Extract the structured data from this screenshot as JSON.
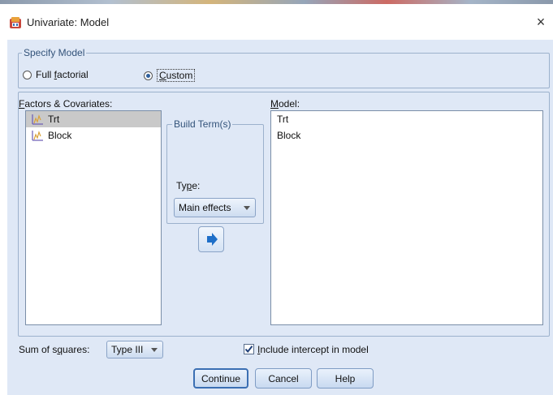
{
  "window": {
    "title": "Univariate: Model",
    "close_glyph": "×"
  },
  "specify_model": {
    "legend": "Specify Model",
    "options": [
      {
        "label_pre": "Full ",
        "label_mnemonic": "f",
        "label_post": "actorial",
        "selected": false
      },
      {
        "label_pre": "",
        "label_mnemonic": "C",
        "label_post": "ustom",
        "selected": true
      }
    ]
  },
  "factors": {
    "label_mnemonic": "F",
    "label_rest": "actors & Covariates:",
    "items": [
      {
        "name": "Trt",
        "selected": true
      },
      {
        "name": "Block",
        "selected": false
      }
    ]
  },
  "model": {
    "label_mnemonic": "M",
    "label_rest": "odel:",
    "items": [
      "Trt",
      "Block"
    ]
  },
  "build_terms": {
    "legend": "Build Term(s)",
    "type_label_pre": "Ty",
    "type_label_mnemonic": "p",
    "type_label_post": "e:",
    "type_value": "Main effects",
    "move_icon": "right-arrow-icon"
  },
  "sum_of_squares": {
    "label_pre": "Sum of s",
    "label_mnemonic": "q",
    "label_post": "uares:",
    "value": "Type III"
  },
  "intercept": {
    "checked": true,
    "label_mnemonic": "I",
    "label_rest": "nclude intercept in model"
  },
  "buttons": {
    "continue": "Continue",
    "cancel": "Cancel",
    "help": "Help"
  },
  "colors": {
    "dialog_bg": "#dfe8f6",
    "group_border": "#9cb1cc",
    "accent": "#3b6fb3",
    "arrow": "#1e6fc8"
  }
}
